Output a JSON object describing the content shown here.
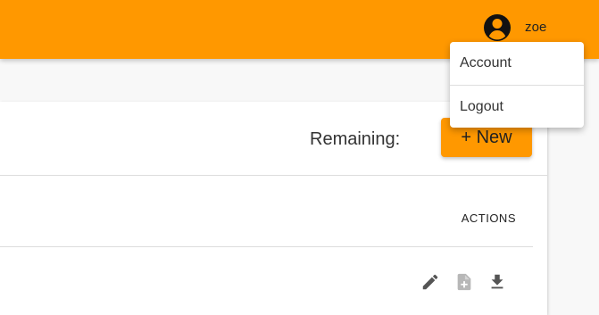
{
  "user": {
    "name": "zoe",
    "avatar_icon": "account-circle-icon"
  },
  "menu": {
    "items": [
      {
        "label": "Account"
      },
      {
        "label": "Logout"
      }
    ]
  },
  "toolbar": {
    "remaining_label": "Remaining:",
    "new_button_label": "+ New"
  },
  "table": {
    "actions_header": "ACTIONS",
    "row_actions": [
      "edit-icon",
      "file-plus-icon",
      "download-icon"
    ]
  },
  "colors": {
    "accent": "#ff9800",
    "background": "#f8f8f8",
    "surface": "#ffffff",
    "text": "#333333"
  }
}
